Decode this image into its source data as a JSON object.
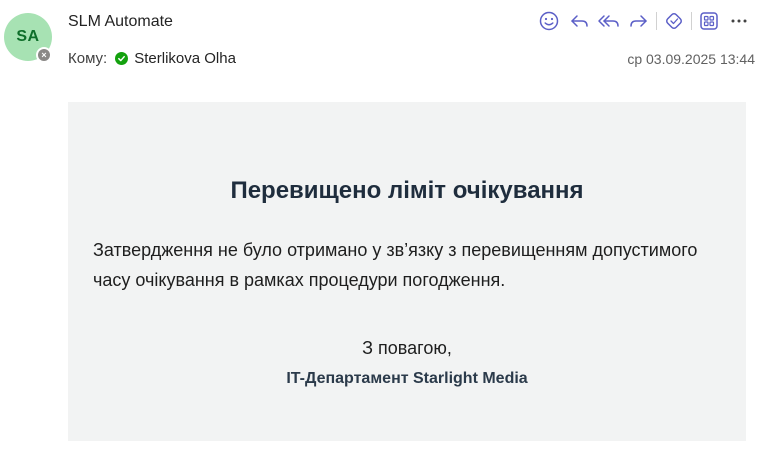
{
  "header": {
    "avatar_initials": "SA",
    "sender_name": "SLM Automate",
    "to_label": "Кому:",
    "recipient": "Sterlikova Olha",
    "date": "ср 03.09.2025 13:44"
  },
  "toolbar": {
    "icons": [
      "emoji-icon",
      "reply-icon",
      "reply-all-icon",
      "forward-icon",
      "immersive-reader-icon",
      "apps-icon",
      "more-icon"
    ],
    "accent_color": "#5b5fc7"
  },
  "message": {
    "title": "Перевищено ліміт очікування",
    "body": "Затвердження не було отримано у зв’язку з перевищенням допустимого часу очікування в рамках процедури погодження.",
    "regards": "З повагою,",
    "signature": "IT-Департамент Starlight Media"
  },
  "colors": {
    "avatar_bg": "#a7e2b3",
    "presence_ok": "#13a10e",
    "panel_bg": "#f2f3f3"
  }
}
